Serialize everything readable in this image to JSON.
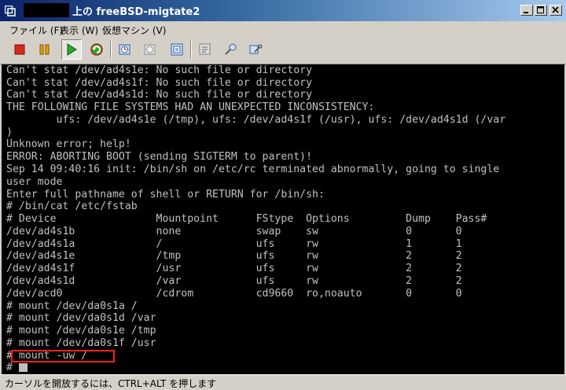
{
  "window": {
    "title": "上の freeBSD-migtate2"
  },
  "menu": [
    "ファイル (F)",
    "表示 (W)",
    "仮想マシン (V)"
  ],
  "toolbar": {
    "icons": [
      "stop-icon",
      "pause-icon",
      "play-icon",
      "reset-icon",
      "snapshot-icon",
      "revert-snapshot-icon",
      "snapshot-manager-icon",
      "settings-icon",
      "tools-icon",
      "connect-icon"
    ]
  },
  "console": {
    "lines": [
      "Can't stat /dev/ad4s1e: No such file or directory",
      "Can't stat /dev/ad4s1f: No such file or directory",
      "Can't stat /dev/ad4s1d: No such file or directory",
      "THE FOLLOWING FILE SYSTEMS HAD AN UNEXPECTED INCONSISTENCY:",
      "        ufs: /dev/ad4s1e (/tmp), ufs: /dev/ad4s1f (/usr), ufs: /dev/ad4s1d (/var",
      ")",
      "Unknown error; help!",
      "ERROR: ABORTING BOOT (sending SIGTERM to parent)!",
      "Sep 14 09:40:16 init: /bin/sh on /etc/rc terminated abnormally, going to single",
      "user mode",
      "Enter full pathname of shell or RETURN for /bin/sh:",
      "# /bin/cat /etc/fstab",
      "# Device                Mountpoint      FStype  Options         Dump    Pass#",
      "/dev/ad4s1b             none            swap    sw              0       0",
      "/dev/ad4s1a             /               ufs     rw              1       1",
      "/dev/ad4s1e             /tmp            ufs     rw              2       2",
      "/dev/ad4s1f             /usr            ufs     rw              2       2",
      "/dev/ad4s1d             /var            ufs     rw              2       2",
      "/dev/acd0               /cdrom          cd9660  ro,noauto       0       0",
      "# mount /dev/da0s1a /",
      "# mount /dev/da0s1d /var",
      "# mount /dev/da0s1e /tmp",
      "# mount /dev/da0s1f /usr",
      "# mount -uw /",
      "#"
    ]
  },
  "status": {
    "text": "カーソルを開放するには、CTRL+ALT を押します"
  },
  "colors": {
    "console_bg": "#000000",
    "console_fg": "#c0c0c0",
    "highlight": "#ff2020",
    "title_gradient_start": "#0a246a"
  }
}
